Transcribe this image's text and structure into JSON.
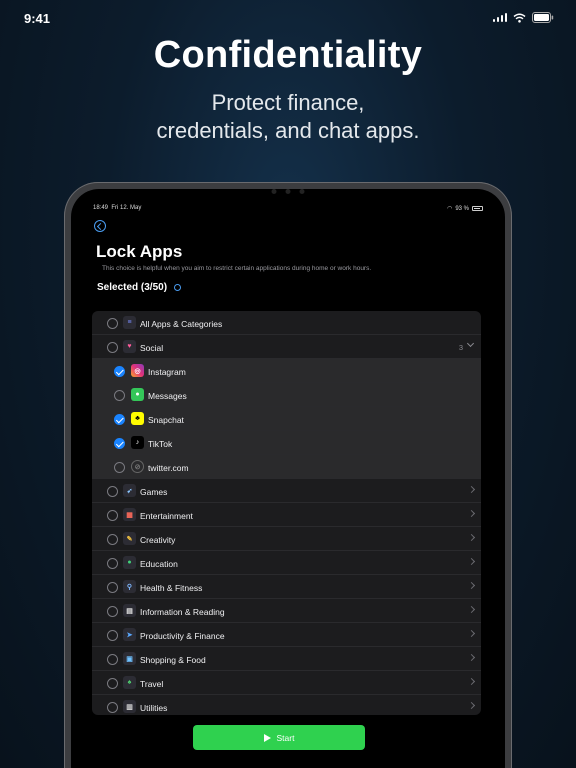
{
  "status_bar": {
    "time": "9:41"
  },
  "headline": "Confidentiality",
  "subheadline": [
    "Protect finance,",
    "credentials, and chat apps."
  ],
  "device": {
    "status": {
      "time": "18:49",
      "date": "Fri 12. May",
      "battery": "93 %"
    },
    "title": "Lock Apps",
    "description": "This choice is helpful when you aim to restrict certain applications during home or work hours.",
    "selected_label": "Selected (3/50)",
    "list": {
      "all": "All Apps & Categories",
      "social": {
        "label": "Social",
        "count": "3"
      },
      "social_apps": [
        {
          "label": "Instagram",
          "checked": true
        },
        {
          "label": "Messages",
          "checked": false
        },
        {
          "label": "Snapchat",
          "checked": true
        },
        {
          "label": "TikTok",
          "checked": true
        },
        {
          "label": "twitter.com",
          "checked": false
        }
      ],
      "categories": [
        "Games",
        "Entertainment",
        "Creativity",
        "Education",
        "Health & Fitness",
        "Information & Reading",
        "Productivity & Finance",
        "Shopping & Food",
        "Travel",
        "Utilities"
      ]
    },
    "start_label": "Start"
  },
  "colors": {
    "accent": "#1a84ff",
    "start_button": "#2fd14f"
  }
}
